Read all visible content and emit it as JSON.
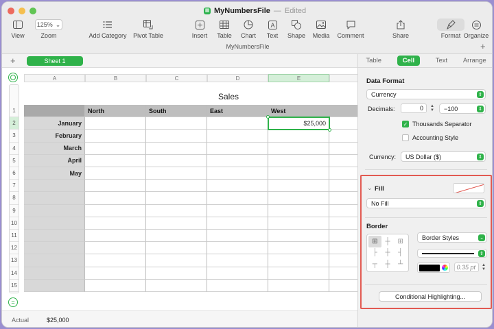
{
  "window": {
    "doc_icon": "numbers-doc-icon",
    "title": "MyNumbersFile",
    "separator": "—",
    "status": "Edited",
    "subtitle": "MyNumbersFile",
    "traffic_colors": [
      "#ed6a5e",
      "#f5bf4f",
      "#61c554"
    ]
  },
  "toolbar": {
    "view": "View",
    "zoom_value": "125%",
    "zoom": "Zoom",
    "add_category": "Add Category",
    "pivot_table": "Pivot Table",
    "insert": "Insert",
    "table": "Table",
    "chart": "Chart",
    "text": "Text",
    "shape": "Shape",
    "media": "Media",
    "comment": "Comment",
    "share": "Share",
    "format": "Format",
    "organize": "Organize",
    "plus": "+"
  },
  "sheets": {
    "add": "+",
    "active_sheet": "Sheet 1",
    "accent": "#2fb24a"
  },
  "grid": {
    "columns": [
      "A",
      "B",
      "C",
      "D",
      "E"
    ],
    "selected_column": "E",
    "rows": [
      "1",
      "2",
      "3",
      "4",
      "5",
      "6",
      "7",
      "8",
      "9",
      "10",
      "11",
      "12",
      "13",
      "14",
      "15"
    ],
    "selected_row": "2",
    "table_title": "Sales",
    "headers": [
      "North",
      "South",
      "East",
      "West"
    ],
    "row_labels": [
      "January",
      "February",
      "March",
      "April",
      "May"
    ],
    "active_cell_value": "$25,000"
  },
  "status": {
    "label": "Actual",
    "value": "$25,000"
  },
  "inspector": {
    "tabs": [
      "Table",
      "Cell",
      "Text",
      "Arrange"
    ],
    "active_tab": "Cell",
    "data_format_title": "Data Format",
    "data_format_value": "Currency",
    "decimals_label": "Decimals:",
    "decimals_value": "0",
    "negative_value": "−100",
    "thousands_label": "Thousands Separator",
    "thousands_checked": true,
    "accounting_label": "Accounting Style",
    "accounting_checked": false,
    "currency_label": "Currency:",
    "currency_value": "US Dollar ($)",
    "fill_title": "Fill",
    "fill_value": "No Fill",
    "border_title": "Border",
    "border_styles": "Border Styles",
    "border_color": "#000000",
    "border_width": "0.35 pt",
    "conditional": "Conditional Highlighting...",
    "highlight_color": "#e25a52"
  }
}
